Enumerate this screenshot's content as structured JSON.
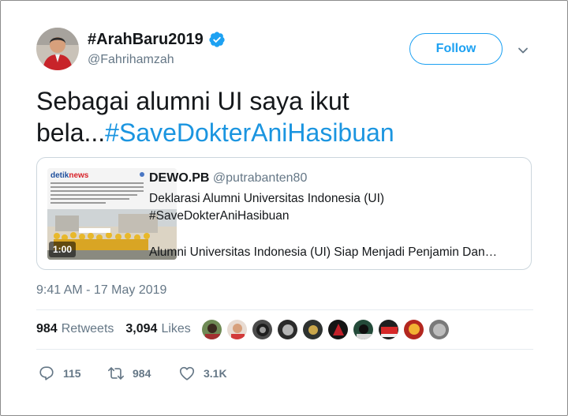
{
  "tweet": {
    "display_name": "#ArahBaru2019",
    "handle": "@Fahrihamzah",
    "follow_label": "Follow",
    "text_plain": "Sebagai alumni UI saya ikut bela...",
    "text_hashtag": "#SaveDokterAniHasibuan",
    "timestamp": "9:41 AM - 17 May 2019"
  },
  "quote": {
    "name": "DEWO.PB",
    "handle": "@putrabanten80",
    "line1": "Deklarasi Alumni Universitas Indonesia (UI)",
    "line2": "#SaveDokterAniHasibuan",
    "line3": "Alumni Universitas Indonesia (UI) Siap Menjadi Penjamin Dan…",
    "thumb_brand": "detiknews",
    "thumb_text": "Ikatan Keluarga Besar UI (IKB UI) melakukan aksi bela dokter Ani Hasibuan di Kampus UI Salemba, Jumat (17/5). Diketahui, dokter Ani dipolisikan terkait pemberitaan mengenai gugurnya petugas KPPS.",
    "video_duration": "1:00"
  },
  "stats": {
    "retweets_count": "984",
    "retweets_label": "Retweets",
    "likes_count": "3,094",
    "likes_label": "Likes"
  },
  "actions": {
    "reply_count": "115",
    "retweet_count": "984",
    "like_count": "3.1K"
  },
  "colors": {
    "brand_blue": "#1da1f2",
    "hashtag_blue": "#1b95e0",
    "secondary_text": "#657786",
    "border": "#ccd6dd"
  },
  "icons": {
    "verified": "verified-badge-icon",
    "chevron": "chevron-down-icon",
    "reply": "reply-icon",
    "retweet": "retweet-icon",
    "like": "heart-icon"
  }
}
